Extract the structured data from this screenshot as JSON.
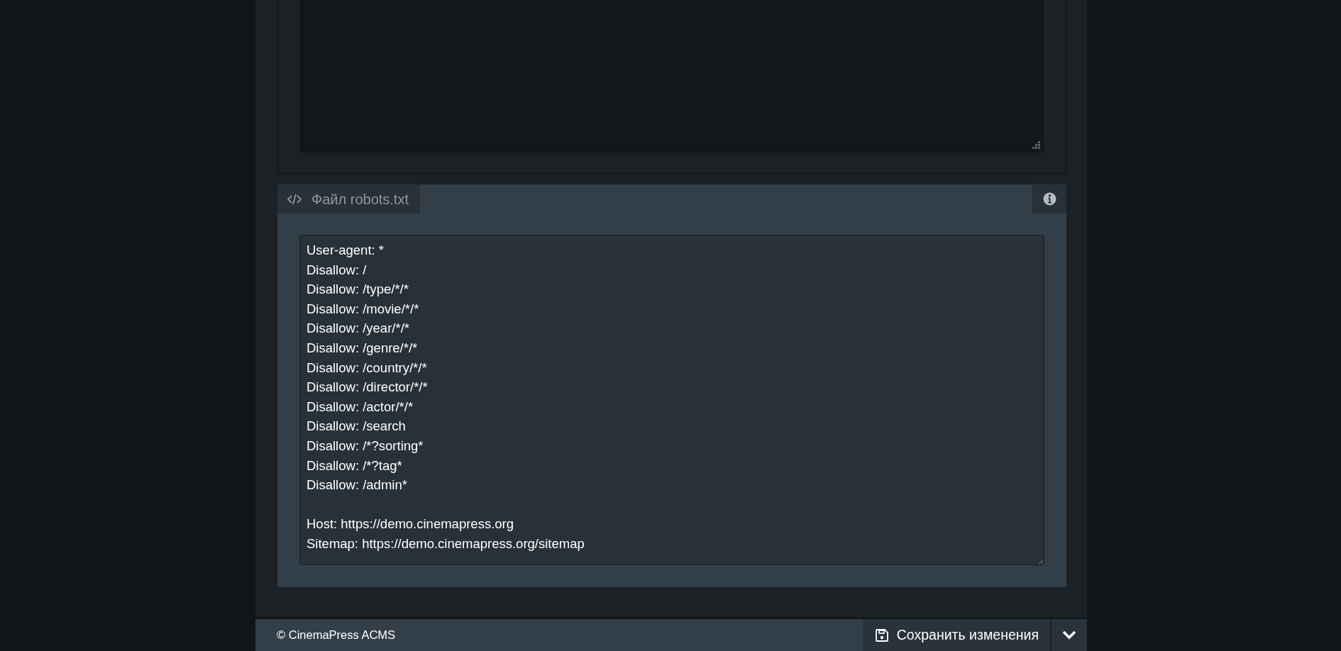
{
  "panel": {
    "title": "Файл robots.txt",
    "blocks": [
      [
        "User-agent: *",
        "Disallow: /",
        "Disallow: /type/*/*",
        "Disallow: /movie/*/*",
        "Disallow: /year/*/*",
        "Disallow: /genre/*/*",
        "Disallow: /country/*/*",
        "Disallow: /director/*/*",
        "Disallow: /actor/*/*",
        "Disallow: /search",
        "Disallow: /*?sorting*",
        "Disallow: /*?tag*",
        "Disallow: /admin*"
      ],
      [
        "Host: https://demo.cinemapress.org",
        "Sitemap: https://demo.cinemapress.org/sitemap"
      ]
    ]
  },
  "footer": {
    "copyright": "© CinemaPress ACMS",
    "save_button": "Сохранить изменения"
  }
}
